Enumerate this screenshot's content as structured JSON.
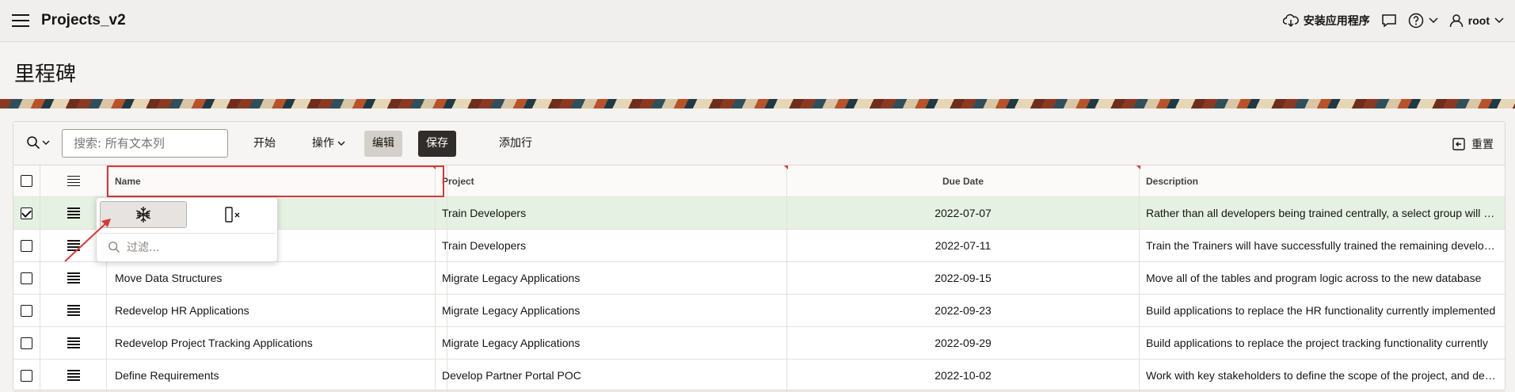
{
  "header": {
    "app_title": "Projects_v2",
    "install_label": "安装应用程序",
    "user_label": "root",
    "icons": [
      "hamburger-icon",
      "cloud-download-icon",
      "chat-icon",
      "help-icon",
      "user-icon"
    ]
  },
  "page": {
    "title": "里程碑"
  },
  "toolbar": {
    "search_placeholder": "搜索: 所有文本列",
    "go_label": "开始",
    "actions_label": "操作",
    "edit_label": "编辑",
    "save_label": "保存",
    "add_row_label": "添加行",
    "reset_label": "重置"
  },
  "grid": {
    "columns": [
      "Name",
      "Project",
      "Due Date",
      "Description"
    ],
    "rows": [
      {
        "name": "",
        "project": "Train Developers",
        "due": "2022-07-07",
        "desc": "Rather than all developers being trained centrally, a select group will be trained",
        "selected": true
      },
      {
        "name": "",
        "project": "Train Developers",
        "due": "2022-07-11",
        "desc": "Train the Trainers will have successfully trained the remaining developers",
        "selected": false
      },
      {
        "name": "Move Data Structures",
        "project": "Migrate Legacy Applications",
        "due": "2022-09-15",
        "desc": "Move all of the tables and program logic across to the new database",
        "selected": false
      },
      {
        "name": "Redevelop HR Applications",
        "project": "Migrate Legacy Applications",
        "due": "2022-09-23",
        "desc": "Build applications to replace the HR functionality currently implemented",
        "selected": false
      },
      {
        "name": "Redevelop Project Tracking Applications",
        "project": "Migrate Legacy Applications",
        "due": "2022-09-29",
        "desc": "Build applications to replace the project tracking functionality currently",
        "selected": false
      },
      {
        "name": "Define Requirements",
        "project": "Develop Partner Portal POC",
        "due": "2022-10-02",
        "desc": "Work with key stakeholders to define the scope of the project, and define",
        "selected": false
      }
    ]
  },
  "popup": {
    "filter_placeholder": "过滤..."
  },
  "colors": {
    "accent_red": "#d33a3a",
    "selected_row": "#e5f1e2",
    "save_bg": "#312d2a"
  }
}
